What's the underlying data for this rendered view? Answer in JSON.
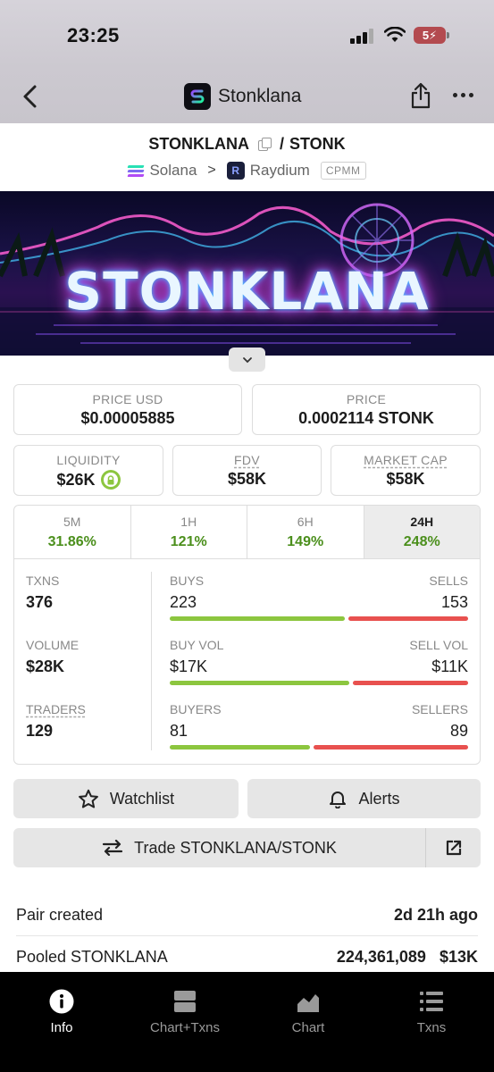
{
  "status_bar": {
    "time": "23:25",
    "battery": "5"
  },
  "nav": {
    "app_name": "Stonklana"
  },
  "pair": {
    "base": "STONKLANA",
    "separator": "/",
    "quote": "STONK",
    "chain": "Solana",
    "dex": "Raydium",
    "pool_type": "CPMM"
  },
  "banner": {
    "text": "STONKLANA"
  },
  "prices": {
    "price_usd_label": "PRICE USD",
    "price_usd": "$0.00005885",
    "price_label": "PRICE",
    "price": "0.0002114 STONK"
  },
  "metrics": {
    "liquidity_label": "LIQUIDITY",
    "liquidity": "$26K",
    "fdv_label": "FDV",
    "fdv": "$58K",
    "mcap_label": "MARKET CAP",
    "mcap": "$58K"
  },
  "periods": [
    {
      "label": "5M",
      "change": "31.86%"
    },
    {
      "label": "1H",
      "change": "121%"
    },
    {
      "label": "6H",
      "change": "149%"
    },
    {
      "label": "24H",
      "change": "248%",
      "active": true
    }
  ],
  "stats": {
    "txns": {
      "label": "TXNS",
      "value": "376",
      "left_label": "BUYS",
      "left_value": "223",
      "right_label": "SELLS",
      "right_value": "153",
      "buy_share": 0.593
    },
    "volume": {
      "label": "VOLUME",
      "value": "$28K",
      "left_label": "BUY VOL",
      "left_value": "$17K",
      "right_label": "SELL VOL",
      "right_value": "$11K",
      "buy_share": 0.607
    },
    "traders": {
      "label": "TRADERS",
      "value": "129",
      "left_label": "BUYERS",
      "left_value": "81",
      "right_label": "SELLERS",
      "right_value": "89",
      "buy_share": 0.476
    }
  },
  "actions": {
    "watchlist": "Watchlist",
    "alerts": "Alerts",
    "trade": "Trade STONKLANA/STONK"
  },
  "info": {
    "pair_created_label": "Pair created",
    "pair_created_value": "2d 21h ago",
    "pooled_label": "Pooled STONKLANA",
    "pooled_amount": "224,361,089",
    "pooled_usd": "$13K"
  },
  "tabbar": {
    "info": "Info",
    "chart_txns": "Chart+Txns",
    "chart": "Chart",
    "txns": "Txns"
  },
  "colors": {
    "positive": "#4b8f1c",
    "buy_bar": "#8cc63f",
    "sell_bar": "#e8514f"
  }
}
